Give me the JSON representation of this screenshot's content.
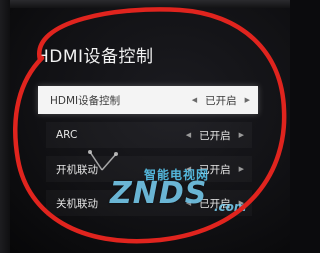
{
  "page": {
    "title": "HDMI设备控制"
  },
  "menu": {
    "items": [
      {
        "label": "HDMI设备控制",
        "value": "已开启"
      },
      {
        "label": "ARC",
        "value": "已开启"
      },
      {
        "label": "开机联动",
        "value": "已开启"
      },
      {
        "label": "关机联动",
        "value": "已开启"
      }
    ],
    "selected_index": 0,
    "left_arrow": "◀",
    "right_arrow": "▶"
  },
  "watermark": {
    "cn_text": "智能电视网",
    "brand_text": "ZNDS",
    "domain_suffix": ".com"
  },
  "colors": {
    "highlight_bg": "#f4f4f4",
    "annotation_red": "#e0241e",
    "watermark_blue": "#78cdf0"
  }
}
